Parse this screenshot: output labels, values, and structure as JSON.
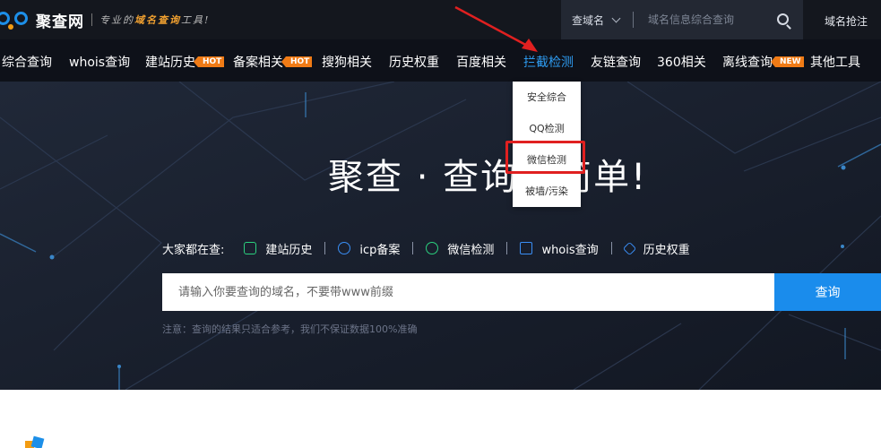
{
  "brand": {
    "name": "聚查网",
    "slogan_pre": "专业的",
    "slogan_hl": "域名查询",
    "slogan_post": "工具!",
    "accent": "#1d8fe8"
  },
  "top_search": {
    "select_value": "查域名",
    "placeholder": "域名信息综合查询",
    "right_link": "域名抢注"
  },
  "nav": {
    "items": [
      {
        "label": "综合查询"
      },
      {
        "label": "whois查询"
      },
      {
        "label": "建站历史",
        "badge": "HOT"
      },
      {
        "label": "备案相关",
        "badge": "HOT"
      },
      {
        "label": "搜狗相关"
      },
      {
        "label": "历史权重"
      },
      {
        "label": "百度相关"
      },
      {
        "label": "拦截检测",
        "active": true
      },
      {
        "label": "友链查询"
      },
      {
        "label": "360相关"
      },
      {
        "label": "离线查询",
        "badge": "NEW"
      },
      {
        "label": "其他工具"
      }
    ],
    "active_color": "#2e9bf0",
    "badge_color": "#f07b16"
  },
  "dropdown": {
    "items": [
      "安全综合",
      "QQ检测",
      "微信检测",
      "被墙/污染"
    ],
    "highlighted": "微信检测",
    "highlight_color": "#e02020"
  },
  "hero": {
    "title": "聚查 · 查询更简单!",
    "popular_lead": "大家都在查:",
    "popular": [
      {
        "label": "建站历史",
        "icon": "history-icon"
      },
      {
        "label": "icp备案",
        "icon": "icp-icon"
      },
      {
        "label": "微信检测",
        "icon": "wechat-icon"
      },
      {
        "label": "whois查询",
        "icon": "monitor-icon"
      },
      {
        "label": "历史权重",
        "icon": "layers-icon"
      }
    ],
    "search_placeholder": "请输入你要查询的域名，不要带www前缀",
    "search_button": "查询",
    "note": "注意：查询的结果只适合参考，我们不保证数据100%准确"
  }
}
